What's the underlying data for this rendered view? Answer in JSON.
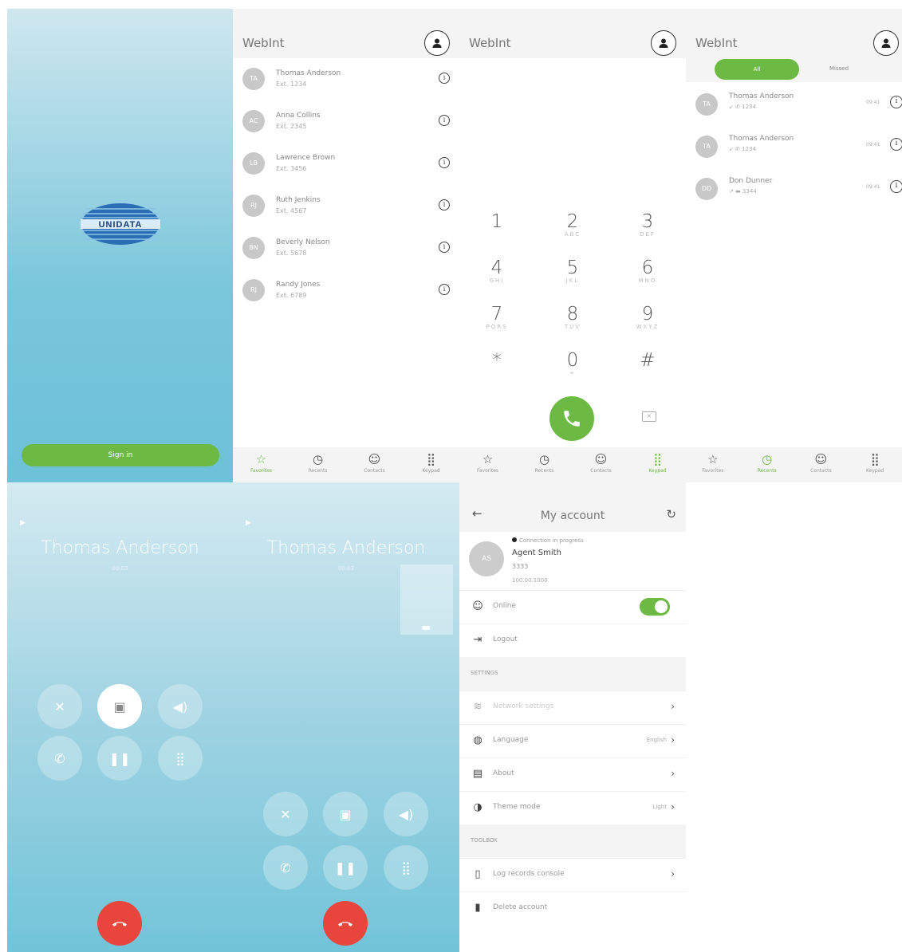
{
  "login": {
    "brand": "UNIDATA",
    "sign_in": "Sign in"
  },
  "app": {
    "title": "WebInt"
  },
  "contacts": [
    {
      "initials": "TA",
      "name": "Thomas Anderson",
      "ext": "Ext. 1234"
    },
    {
      "initials": "AC",
      "name": "Anna Collins",
      "ext": "Ext. 2345"
    },
    {
      "initials": "LB",
      "name": "Lawrence Brown",
      "ext": "Ext. 3456"
    },
    {
      "initials": "RJ",
      "name": "Ruth Jenkins",
      "ext": "Ext. 4567"
    },
    {
      "initials": "BN",
      "name": "Beverly Nelson",
      "ext": "Ext. 5678"
    },
    {
      "initials": "RJ",
      "name": "Randy Jones",
      "ext": "Ext. 6789"
    }
  ],
  "nav": {
    "favorites": "Favorites",
    "recents": "Recents",
    "contacts": "Contacts",
    "keypad": "Keypad"
  },
  "keypad": {
    "keys": [
      {
        "d": "1",
        "l": ""
      },
      {
        "d": "2",
        "l": "ABC"
      },
      {
        "d": "3",
        "l": "DEF"
      },
      {
        "d": "4",
        "l": "GHI"
      },
      {
        "d": "5",
        "l": "JKL"
      },
      {
        "d": "6",
        "l": "MNO"
      },
      {
        "d": "7",
        "l": "PQRS"
      },
      {
        "d": "8",
        "l": "TUV"
      },
      {
        "d": "9",
        "l": "WXYZ"
      },
      {
        "d": "*",
        "l": ""
      },
      {
        "d": "0",
        "l": "+"
      },
      {
        "d": "#",
        "l": ""
      }
    ]
  },
  "recents": {
    "tab_all": "All",
    "tab_missed": "Missed",
    "items": [
      {
        "initials": "TA",
        "name": "Thomas Anderson",
        "sub": "↙ ✆ 1234",
        "time": "09:41"
      },
      {
        "initials": "TA",
        "name": "Thomas Anderson",
        "sub": "↙ ✆ 1234",
        "time": "09:41"
      },
      {
        "initials": "DD",
        "name": "Don Dunner",
        "sub": "↗ ▬ 3344",
        "time": "09:41"
      }
    ]
  },
  "call": {
    "name": "Thomas Anderson",
    "status": "00:03"
  },
  "account": {
    "title": "My account",
    "initials": "AS",
    "status": "Connection in progress",
    "name": "Agent Smith",
    "ext": "3333",
    "ip": "100.00.1000",
    "online": "Online",
    "logout": "Logout",
    "settings_header": "SETTINGS",
    "network": "Network settings",
    "language": "Language",
    "language_value": "English",
    "about": "About",
    "theme": "Theme mode",
    "theme_value": "Light",
    "troubleshoot_header": "TOOLBOX",
    "log_console": "Log records console",
    "delete_account": "Delete account"
  },
  "colors": {
    "accent": "#6cba44",
    "hangup": "#e8453c"
  }
}
